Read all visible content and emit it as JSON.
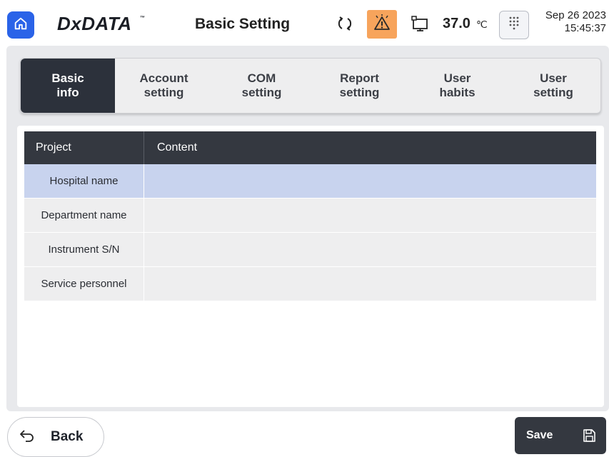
{
  "header": {
    "brand": "DxDATA",
    "brand_tm": "™",
    "title": "Basic Setting",
    "temperature": "37.0",
    "temperature_unit": "℃",
    "date": "Sep 26 2023",
    "time": "15:45:37",
    "icons": [
      "home-icon",
      "sync-icon",
      "alarm-warning-icon",
      "monitor-icon",
      "keypad-icon"
    ]
  },
  "tabs": [
    {
      "label_line1": "Basic",
      "label_line2": "info",
      "active": true
    },
    {
      "label_line1": "Account",
      "label_line2": "setting",
      "active": false
    },
    {
      "label_line1": "COM",
      "label_line2": "setting",
      "active": false
    },
    {
      "label_line1": "Report",
      "label_line2": "setting",
      "active": false
    },
    {
      "label_line1": "User",
      "label_line2": "habits",
      "active": false
    },
    {
      "label_line1": "User",
      "label_line2": "setting",
      "active": false
    }
  ],
  "table": {
    "columns": [
      "Project",
      "Content"
    ],
    "rows": [
      {
        "project": "Hospital name",
        "content": "",
        "selected": true
      },
      {
        "project": "Department name",
        "content": "",
        "selected": false
      },
      {
        "project": "Instrument S/N",
        "content": "",
        "selected": false
      },
      {
        "project": "Service personnel",
        "content": "",
        "selected": false
      }
    ]
  },
  "footer": {
    "back_label": "Back",
    "save_label": "Save"
  },
  "colors": {
    "home_button": "#2a63e8",
    "alarm_button": "#f7a45c",
    "active_tab": "#2c313b",
    "table_header": "#343840",
    "selected_row": "#c8d3ee",
    "save_button": "#343840"
  }
}
